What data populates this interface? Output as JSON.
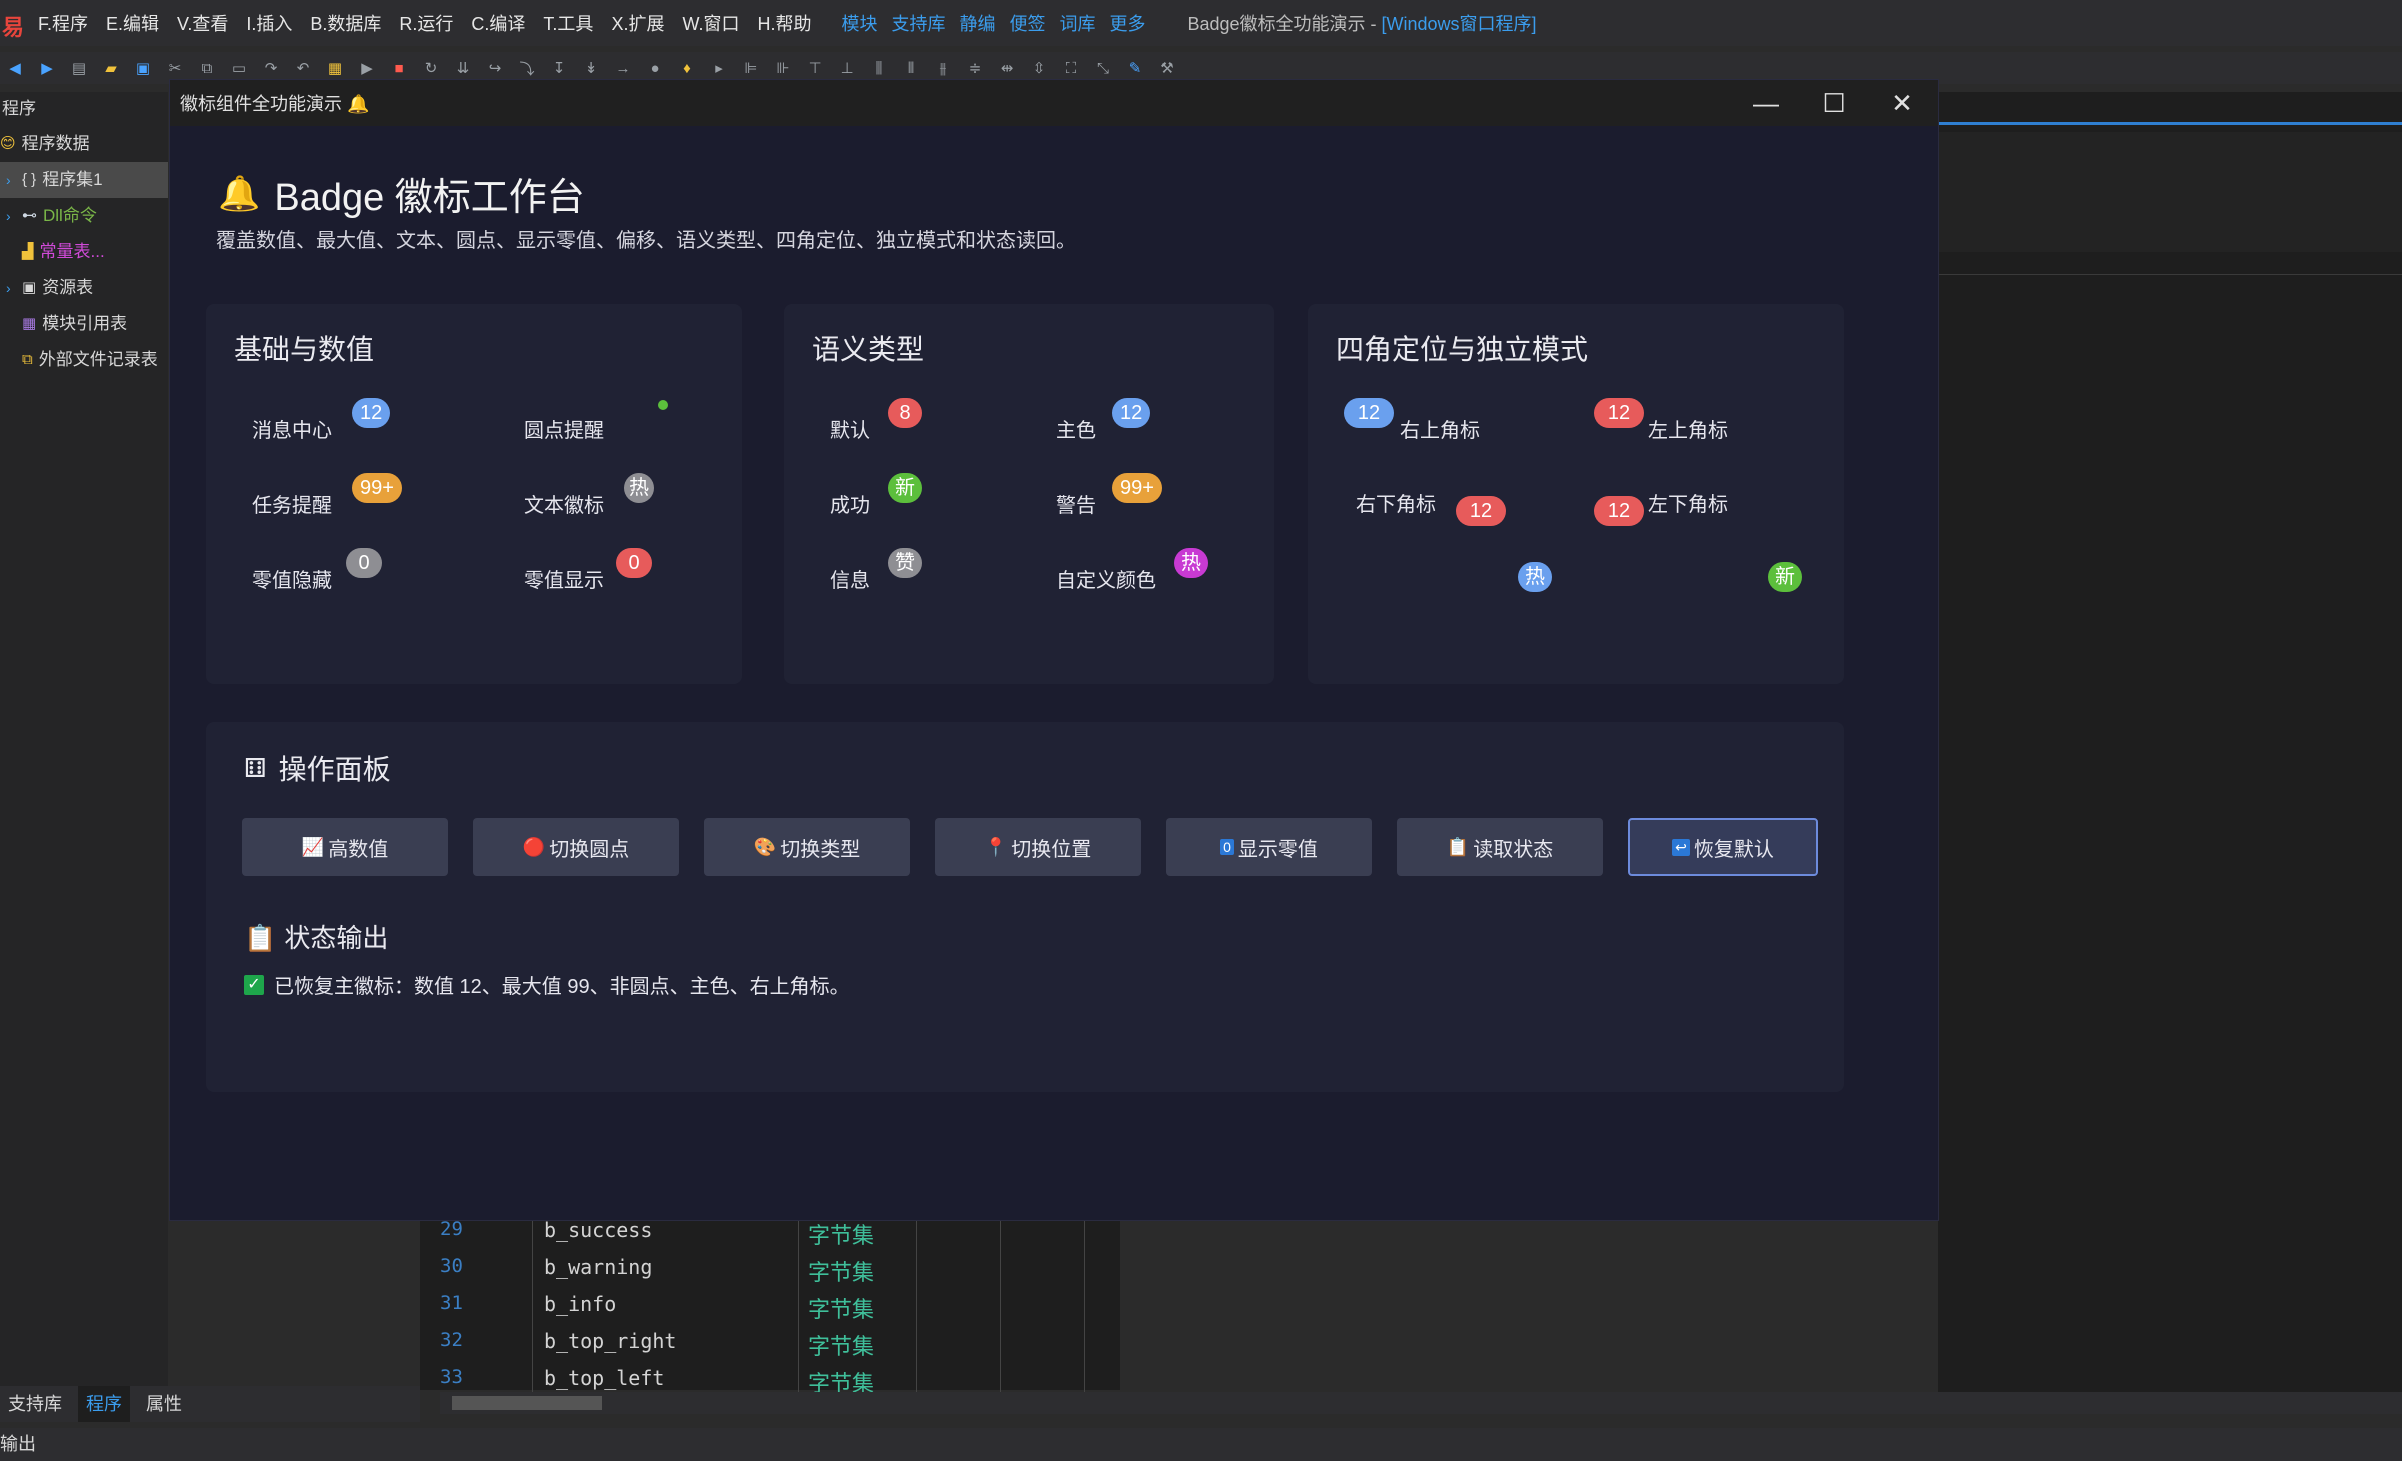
{
  "ide": {
    "menu": [
      "F.程序",
      "E.编辑",
      "V.查看",
      "I.插入",
      "B.数据库",
      "R.运行",
      "C.编译",
      "T.工具",
      "X.扩展",
      "W.窗口",
      "H.帮助"
    ],
    "menu_blue": [
      "模块",
      "支持库",
      "静编",
      "便签",
      "词库",
      "更多"
    ],
    "title_prefix": "Badge徽标全功能演示 - ",
    "title_suffix": "[Windows窗口程序]",
    "left_head": "程序",
    "tree": [
      {
        "label": "程序数据",
        "color": "#d8d8d8",
        "icon": "😊"
      },
      {
        "label": "程序集1",
        "color": "#d8d8d8",
        "icon": "{ }"
      },
      {
        "label": "Dll命令",
        "color": "#7ab648",
        "icon": "⊷"
      },
      {
        "label": "常量表...",
        "color": "#d04ad8",
        "icon": "▟"
      },
      {
        "label": "资源表",
        "color": "#d8d8d8",
        "icon": "▣"
      },
      {
        "label": "模块引用表",
        "color": "#d8d8d8",
        "icon": "▦"
      },
      {
        "label": "外部文件记录表",
        "color": "#d8d8d8",
        "icon": "⧉"
      }
    ],
    "code_rows": [
      {
        "ln": "29",
        "name": "b_success",
        "type": "字节集"
      },
      {
        "ln": "30",
        "name": "b_warning",
        "type": "字节集"
      },
      {
        "ln": "31",
        "name": "b_info",
        "type": "字节集"
      },
      {
        "ln": "32",
        "name": "b_top_right",
        "type": "字节集"
      },
      {
        "ln": "33",
        "name": "b_top_left",
        "type": "字节集"
      }
    ],
    "tabs": [
      "支持库",
      "程序",
      "属性"
    ],
    "output_label": "输出"
  },
  "window": {
    "title": "徽标组件全功能演示 🔔",
    "heading": "Badge 徽标工作台",
    "subtitle": "覆盖数值、最大值、文本、圆点、显示零值、偏移、语义类型、四角定位、独立模式和状态读回。"
  },
  "cards": {
    "basic": {
      "title": "基础与数值",
      "items": [
        {
          "label": "消息中心",
          "badge": "12",
          "type": "primary"
        },
        {
          "label": "圆点提醒",
          "badge": "",
          "type": "success-dot"
        },
        {
          "label": "任务提醒",
          "badge": "99+",
          "type": "warning"
        },
        {
          "label": "文本徽标",
          "badge": "热",
          "type": "info"
        },
        {
          "label": "零值隐藏",
          "badge": "0",
          "type": "info"
        },
        {
          "label": "零值显示",
          "badge": "0",
          "type": "danger"
        }
      ]
    },
    "semantic": {
      "title": "语义类型",
      "items": [
        {
          "label": "默认",
          "badge": "8",
          "type": "danger"
        },
        {
          "label": "主色",
          "badge": "12",
          "type": "primary"
        },
        {
          "label": "成功",
          "badge": "新",
          "type": "success"
        },
        {
          "label": "警告",
          "badge": "99+",
          "type": "warning"
        },
        {
          "label": "信息",
          "badge": "赞",
          "type": "info"
        },
        {
          "label": "自定义颜色",
          "badge": "热",
          "type": "custom"
        }
      ]
    },
    "corners": {
      "title": "四角定位与独立模式",
      "items": [
        {
          "label": "右上角标",
          "badge": "12",
          "type": "primary"
        },
        {
          "label": "左上角标",
          "badge": "12",
          "type": "danger"
        },
        {
          "label": "右下角标",
          "badge": "12",
          "type": "danger"
        },
        {
          "label": "左下角标",
          "badge": "12",
          "type": "danger"
        }
      ],
      "standalone": [
        {
          "badge": "热",
          "type": "primary"
        },
        {
          "badge": "新",
          "type": "success"
        }
      ]
    }
  },
  "ops": {
    "title": "操作面板",
    "buttons": [
      {
        "icon": "📈",
        "label": "高数值"
      },
      {
        "icon": "🔴",
        "label": "切换圆点"
      },
      {
        "icon": "🎨",
        "label": "切换类型"
      },
      {
        "icon": "📍",
        "label": "切换位置"
      },
      {
        "icon": "0",
        "label": "显示零值"
      },
      {
        "icon": "📋",
        "label": "读取状态"
      },
      {
        "icon": "↩",
        "label": "恢复默认"
      }
    ],
    "status_title": "状态输出",
    "status_text": "已恢复主徽标：数值 12、最大值 99、非圆点、主色、右上角标。"
  },
  "colors": {
    "primary": "#6aa0ee",
    "danger": "#e75b5b",
    "warning": "#e8a13a",
    "success": "#5cbf3c",
    "info": "#8e8e93",
    "custom": "#c83ad3"
  }
}
